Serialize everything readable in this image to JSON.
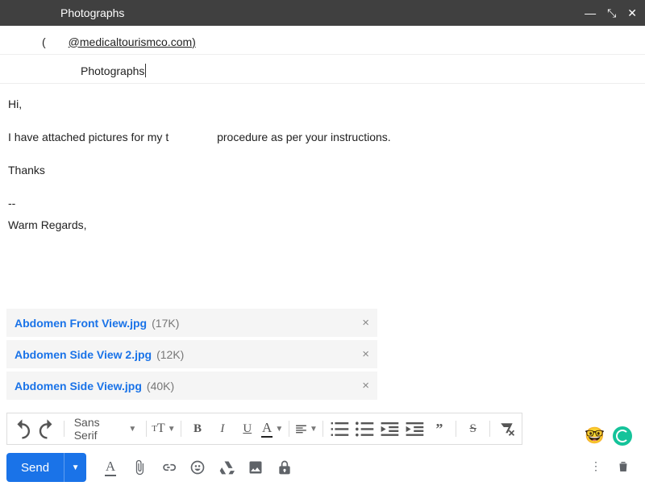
{
  "titlebar": {
    "title": "Photographs"
  },
  "fields": {
    "to_prefix": "",
    "to_email": "@medicaltourismco.com)",
    "to_lparen": "(",
    "subject": "Photographs"
  },
  "body": {
    "l1": "Hi,",
    "l2a": "I have attached pictures for my t",
    "l2b": " procedure as per your instructions.",
    "l3": "Thanks",
    "sigdash": "--",
    "sig1": "Warm Regards,"
  },
  "attachments": [
    {
      "name": "Abdomen Front View.jpg",
      "size": "(17K)"
    },
    {
      "name": "Abdomen Side View 2.jpg",
      "size": "(12K)"
    },
    {
      "name": "Abdomen Side View.jpg",
      "size": "(40K)"
    }
  ],
  "toolbar": {
    "font": "Sans Serif"
  },
  "send": {
    "label": "Send"
  }
}
